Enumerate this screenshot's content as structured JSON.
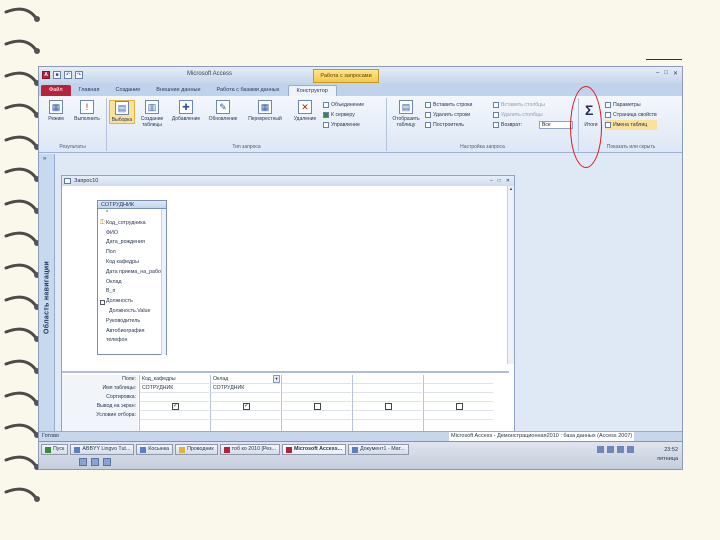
{
  "window": {
    "app_title": "Microsoft Access",
    "context_tab": "Работа с запросами",
    "controls": [
      "–",
      "□",
      "✕"
    ]
  },
  "ribbon_tabs": [
    "Файл",
    "Главная",
    "Создание",
    "Внешние данные",
    "Работа с базами данных",
    "Конструктор"
  ],
  "ribbon": {
    "results": {
      "label": "Результаты",
      "buttons": [
        "Режим",
        "Выполнить"
      ]
    },
    "query_type": {
      "label": "Тип запроса",
      "buttons": [
        "Выборка",
        "Создание таблицы",
        "Добавление",
        "Обновление",
        "Перекрестный",
        "Удаление"
      ],
      "small": [
        "Объединение",
        "К серверу",
        "Управление"
      ]
    },
    "setup": {
      "label": "Настройка запроса",
      "show_table": "Отобразить таблицу",
      "col1": [
        "Вставить строки",
        "Удалить строки",
        "Построитель"
      ],
      "col2": [
        "Вставить столбцы",
        "Удалить столбцы",
        "Возврат:"
      ],
      "return_value": "Все"
    },
    "show_hide": {
      "label": "Показать или скрыть",
      "totals": "Итоги",
      "small": [
        "Параметры",
        "Страница свойств",
        "Имена таблиц"
      ]
    }
  },
  "nav_pane": {
    "title": "Область навигации",
    "toggle": "»"
  },
  "query": {
    "title": "Запрос10",
    "controls": [
      "–",
      "□",
      "✕"
    ],
    "table": {
      "name": "СОТРУДНИК",
      "fields": [
        "*",
        "Код_сотрудника",
        "ФИО",
        "Дата_рождения",
        "Пол",
        "Код кафедры",
        "Дата приема_на_работу",
        "Оклад",
        "В_п",
        "Должность",
        "Должность.Value",
        "Руководитель",
        "Автобиография",
        "телефон"
      ]
    },
    "grid": {
      "row_labels": [
        "Поле:",
        "Имя таблицы:",
        "Сортировка:",
        "Вывод на экран:",
        "Условие отбора:"
      ],
      "columns": [
        {
          "field": "Код_кафедры",
          "table": "СОТРУДНИК",
          "show": true
        },
        {
          "field": "Оклад",
          "table": "СОТРУДНИК",
          "show": true
        },
        {
          "field": "",
          "table": "",
          "show": false
        },
        {
          "field": "",
          "table": "",
          "show": false
        },
        {
          "field": "",
          "table": "",
          "show": false
        }
      ]
    }
  },
  "status": {
    "left": "Готово",
    "window_title": "Microsoft Access - Демонстрационная2010 : база данных (Access 2007)"
  },
  "taskbar": {
    "start": "Пуск",
    "items": [
      "ABBYY Lingvo Tut...",
      "Косынка",
      "Проводник",
      "тоб ко 2010 [Рез...",
      "Microsoft Access...",
      "Документ1 - Мат..."
    ],
    "time": "23:52",
    "day": "пятница"
  }
}
